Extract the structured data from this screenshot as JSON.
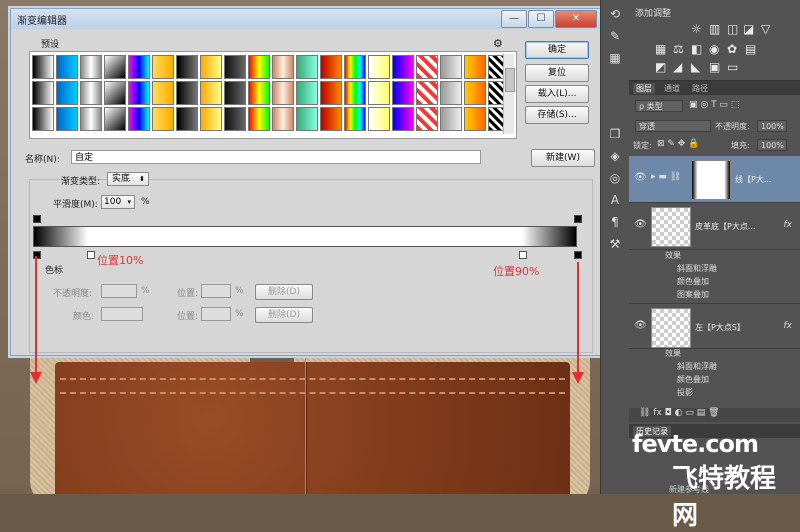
{
  "dialog": {
    "title": "渐变编辑器",
    "window_buttons": {
      "minimize": "—",
      "maximize": "☐",
      "close": "✕"
    },
    "presets_label": "预设",
    "buttons": {
      "ok": "确定",
      "reset": "复位",
      "load": "载入(L)...",
      "save": "存储(S)...",
      "new": "新建(W)"
    },
    "name_label": "名称(N):",
    "name_value": "自定",
    "gradient_type_label": "渐变类型:",
    "gradient_type_value": "实底",
    "smoothness_label": "平滑度(M):",
    "smoothness_value": "100",
    "smoothness_unit": "%",
    "stops": {
      "section_label": "色标",
      "opacity_label": "不透明度:",
      "opacity_unit": "%",
      "location_label": "位置:",
      "location_unit": "%",
      "delete_label": "删除(D)",
      "color_label": "颜色:"
    },
    "stop_locations": [
      0,
      10,
      90,
      100
    ],
    "annotations": {
      "left": "位置10%",
      "right": "位置90%"
    },
    "accent_color": "#d83a3a"
  },
  "panels": {
    "adjustments_title": "添加调整",
    "layers_tabs": [
      "图层",
      "通道",
      "路径"
    ],
    "filter_value": "ρ 类型",
    "blend_mode": "穿透",
    "opacity_label": "不透明度:",
    "opacity_value": "100%",
    "lock_label": "锁定:",
    "fill_label": "填充:",
    "fill_value": "100%",
    "layers": [
      {
        "name": "线【P大...",
        "fx": ""
      },
      {
        "name": "皮革底【P大点...",
        "fx": "fx"
      },
      {
        "name": "左【P大点S】",
        "fx": "fx"
      }
    ],
    "effects_group1": [
      "效果",
      "斜面和浮雕",
      "颜色叠加",
      "图案叠加"
    ],
    "effects_group2": [
      "效果",
      "斜面和浮雕",
      "颜色叠加",
      "投影"
    ],
    "history_tab": "历史记录",
    "history_item": "新建参考线"
  },
  "watermark": {
    "line1": "fevte.com",
    "line2": "飞特教程网"
  }
}
